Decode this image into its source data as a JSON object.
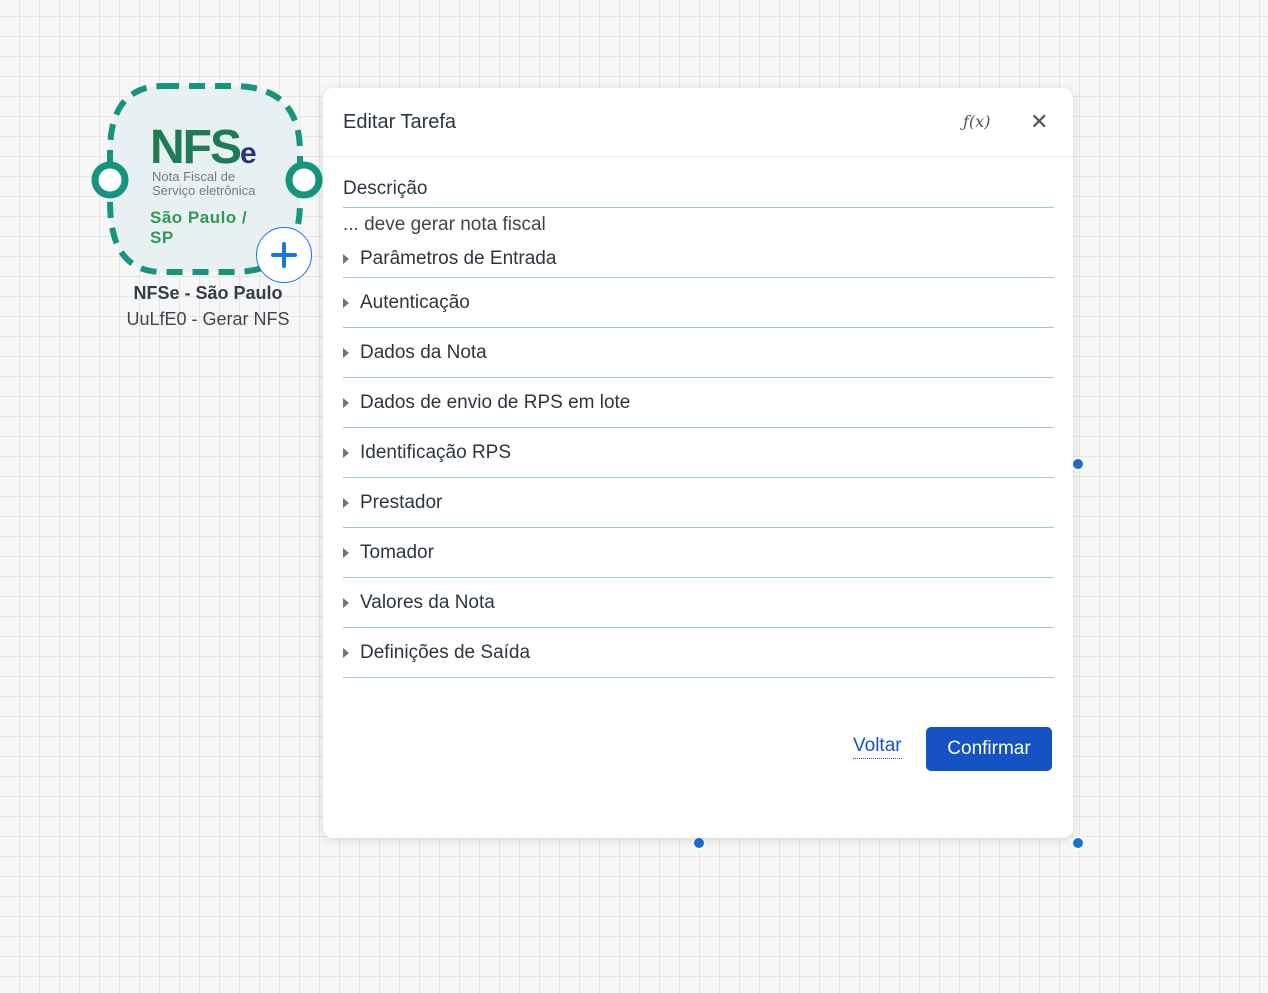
{
  "node": {
    "logo_main": "NFS",
    "logo_e": "e",
    "logo_line1": "Nota Fiscal de",
    "logo_line2": "Serviço eletrônica",
    "logo_city": "São Paulo / SP",
    "title": "NFSe - São Paulo",
    "subtitle": "UuLfE0 - Gerar NFS",
    "add_icon": "plus-icon",
    "colors": {
      "dashed_border": "#16957e",
      "fill": "#e9f0f1",
      "plus": "#1a73e8"
    }
  },
  "modal": {
    "title": "Editar Tarefa",
    "fx_label": "ƒ(x)",
    "close_label": "✕",
    "description_label": "Descrição",
    "description_value": "... deve gerar nota fiscal",
    "sections": [
      "Parâmetros de Entrada",
      "Autenticação",
      "Dados da Nota",
      "Dados de envio de RPS em lote",
      "Identificação RPS",
      "Prestador",
      "Tomador",
      "Valores da Nota",
      "Definições de Saída"
    ],
    "back_label": "Voltar",
    "confirm_label": "Confirmar",
    "colors": {
      "primary": "#1552c4",
      "divider": "#9fc9cf"
    }
  }
}
